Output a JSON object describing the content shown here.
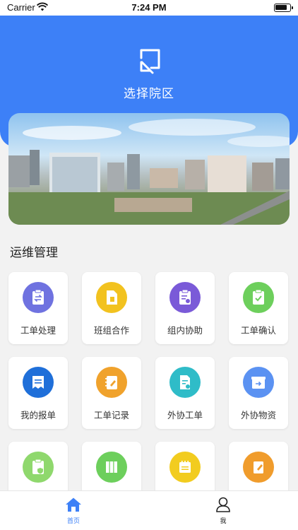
{
  "status_bar": {
    "carrier": "Carrier",
    "time": "7:24 PM"
  },
  "header": {
    "select_campus_label": "选择院区"
  },
  "section": {
    "title": "运维管理"
  },
  "grid_items": [
    {
      "label": "工单处理",
      "icon": "exchange-clipboard-icon",
      "color": "#6f72e0"
    },
    {
      "label": "班组合作",
      "icon": "document-icon",
      "color": "#f2c21f"
    },
    {
      "label": "组内协助",
      "icon": "clipboard-user-icon",
      "color": "#7a5ad8"
    },
    {
      "label": "工单确认",
      "icon": "check-clipboard-icon",
      "color": "#6dcf5c"
    },
    {
      "label": "我的报单",
      "icon": "ticket-icon",
      "color": "#1f6fd9"
    },
    {
      "label": "工单记录",
      "icon": "notebook-pen-icon",
      "color": "#f0a22c"
    },
    {
      "label": "外协工单",
      "icon": "doc-share-icon",
      "color": "#2fbcc8"
    },
    {
      "label": "外协物资",
      "icon": "box-arrow-icon",
      "color": "#5b92f2"
    },
    {
      "label": "",
      "icon": "clipboard-shield-icon",
      "color": "#8fd86d"
    },
    {
      "label": "",
      "icon": "binders-icon",
      "color": "#6dcf5c"
    },
    {
      "label": "",
      "icon": "calendar-notes-icon",
      "color": "#f2cc1f"
    },
    {
      "label": "",
      "icon": "edit-book-icon",
      "color": "#f09c2c"
    }
  ],
  "tabbar": {
    "home_label": "首页",
    "me_label": "我"
  },
  "colors": {
    "primary": "#3d80f7"
  }
}
